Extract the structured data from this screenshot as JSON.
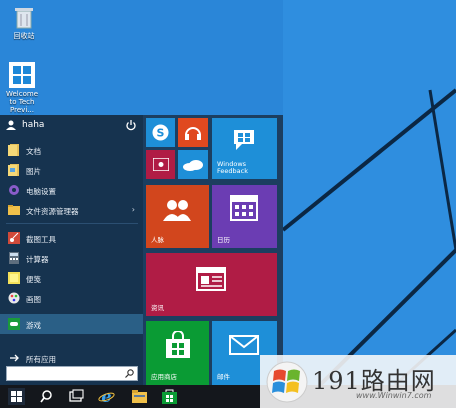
{
  "desktop": {
    "icons": [
      {
        "label": "回收站",
        "icon": "recycle-bin-icon"
      },
      {
        "label": "Welcome to Tech Previ...",
        "icon": "windows-logo-icon"
      }
    ]
  },
  "start_menu": {
    "user": {
      "name": "haha",
      "power_icon": "power-icon"
    },
    "items": [
      {
        "label": "文档",
        "icon": "document-icon"
      },
      {
        "label": "图片",
        "icon": "pictures-icon"
      },
      {
        "label": "电脑设置",
        "icon": "gear-icon"
      },
      {
        "label": "文件资源管理器",
        "icon": "folder-icon",
        "chevron": "›"
      },
      {
        "label": "截图工具",
        "icon": "scissors-icon"
      },
      {
        "label": "计算器",
        "icon": "calculator-icon"
      },
      {
        "label": "便笺",
        "icon": "sticky-note-icon"
      },
      {
        "label": "画图",
        "icon": "paint-icon"
      },
      {
        "label": "游戏",
        "icon": "gamepad-icon"
      }
    ],
    "all_apps": "所有应用",
    "all_apps_icon": "arrow-right-icon",
    "search": {
      "value": "",
      "icon": "search-icon"
    }
  },
  "tiles": {
    "windows_feedback": "Windows Feedback",
    "people": "人脉",
    "calendar": "日历",
    "news": "资讯",
    "store": "应用商店",
    "mail": "邮件"
  },
  "taskbar": {
    "icons": [
      "start-icon",
      "search-icon",
      "task-view-icon",
      "ie-browser-icon",
      "file-explorer-icon",
      "store-icon"
    ]
  },
  "watermark": {
    "text": "191路由网",
    "url": "www.Winwin7.com"
  },
  "colors": {
    "desktop": "#2a86d8",
    "start_menu": "#1c3e60",
    "tile_blue": "#1e8fd8",
    "tile_orange": "#d2461d",
    "tile_purple": "#6b3db3",
    "tile_crimson": "#b01c45",
    "tile_green": "#0a9b34",
    "taskbar": "#14171c"
  }
}
